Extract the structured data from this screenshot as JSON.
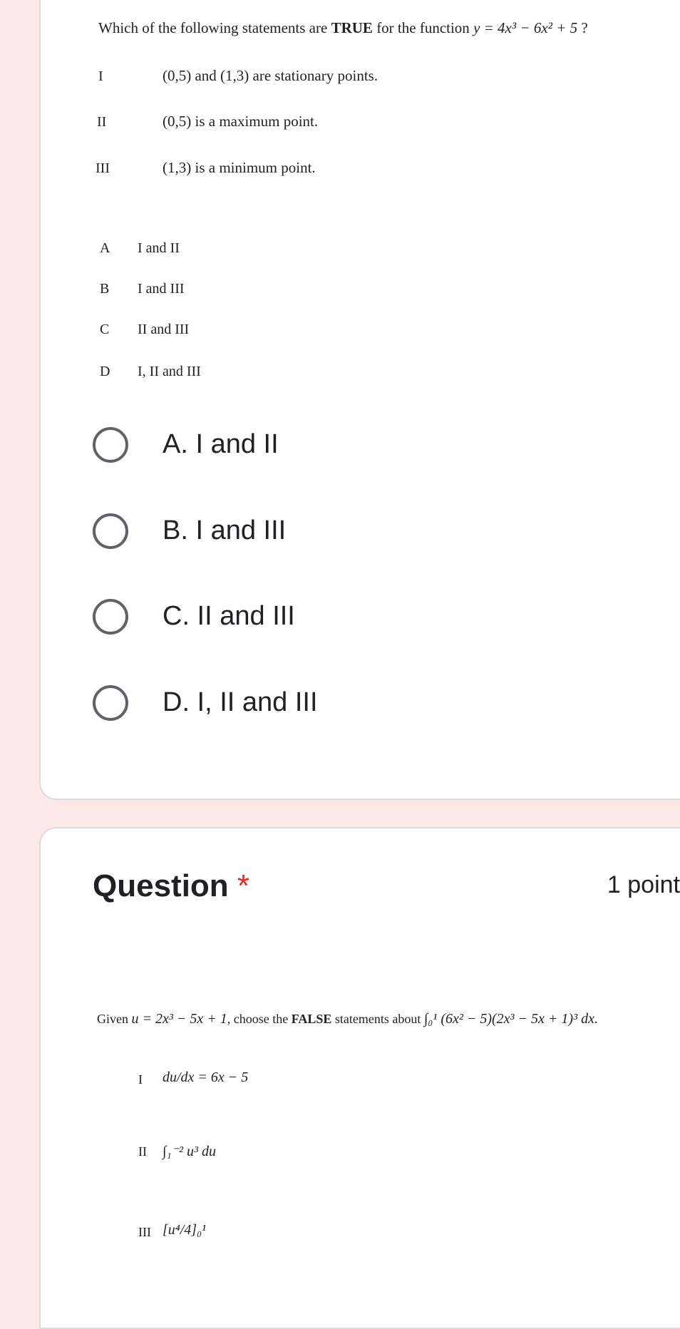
{
  "question1": {
    "stem_prefix": "Which of the following statements are ",
    "stem_bold": "TRUE",
    "stem_suffix": " for the function ",
    "function": "y = 4x³ − 6x² + 5",
    "stem_end": " ?",
    "statements": [
      {
        "numeral": "I",
        "text": "(0,5) and (1,3) are stationary points."
      },
      {
        "numeral": "II",
        "text": "(0,5) is a maximum point."
      },
      {
        "numeral": "III",
        "text": "(1,3) is a minimum point."
      }
    ],
    "image_options": [
      {
        "letter": "A",
        "text": "I and II"
      },
      {
        "letter": "B",
        "text": "I and III"
      },
      {
        "letter": "C",
        "text": "II and III"
      },
      {
        "letter": "D",
        "text": "I, II and III"
      }
    ],
    "choices": [
      "A.  I and II",
      "B.  I and III",
      "C.  II and III",
      "D.  I, II and III"
    ]
  },
  "question2": {
    "title": "Question",
    "required_mark": "*",
    "points": "1 point",
    "stem_prefix": "Given ",
    "u_def": "u = 2x³ − 5x + 1",
    "stem_mid": ", choose the ",
    "stem_bold": "FALSE",
    "stem_suffix": " statements about ",
    "integral": "∫₀¹ (6x² − 5)(2x³ − 5x + 1)³ dx.",
    "statements": [
      {
        "numeral": "I",
        "text": "du/dx = 6x − 5"
      },
      {
        "numeral": "II",
        "text": "∫₁⁻² u³ du"
      },
      {
        "numeral": "III",
        "text": "[u⁴/4]₀¹"
      }
    ]
  },
  "colors": {
    "background": "#fce8e6",
    "card": "#ffffff",
    "required": "#d93025",
    "radio": "#5f6368"
  }
}
